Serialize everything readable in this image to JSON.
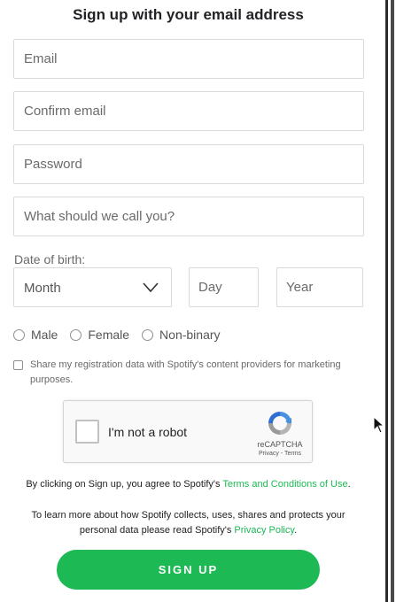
{
  "title": "Sign up with your email address",
  "fields": {
    "email": {
      "placeholder": "Email",
      "value": ""
    },
    "confirm_email": {
      "placeholder": "Confirm email",
      "value": ""
    },
    "password": {
      "placeholder": "Password",
      "value": ""
    },
    "name": {
      "placeholder": "What should we call you?",
      "value": ""
    }
  },
  "dob": {
    "label": "Date of birth:",
    "month": "Month",
    "day_placeholder": "Day",
    "year_placeholder": "Year"
  },
  "gender": {
    "male": "Male",
    "female": "Female",
    "nonbinary": "Non-binary"
  },
  "share_text": "Share my registration data with Spotify's content providers for marketing purposes.",
  "captcha": {
    "label": "I'm not a robot",
    "brand": "reCAPTCHA",
    "links": "Privacy - Terms"
  },
  "terms": {
    "prefix": "By clicking on Sign up, you agree to Spotify's ",
    "link": "Terms and Conditions of Use",
    "suffix": "."
  },
  "privacy": {
    "prefix": "To learn more about how Spotify collects, uses, shares and protects your personal data please read Spotify's ",
    "link": "Privacy Policy",
    "suffix": "."
  },
  "signup_button": "SIGN UP",
  "icons": {
    "month_dropdown": "chevron-down-icon",
    "captcha_logo": "recaptcha-logo-icon",
    "cursor": "cursor-icon"
  },
  "colors": {
    "accent": "#1db954",
    "border": "#d9dadc",
    "placeholder": "#6a6a6a"
  }
}
